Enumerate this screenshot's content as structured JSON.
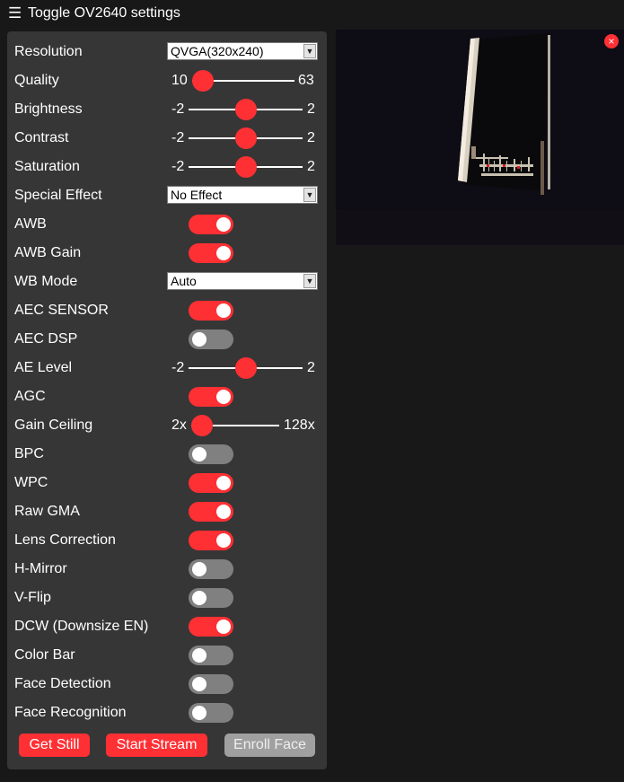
{
  "header": {
    "menu_icon": "☰",
    "title": "Toggle OV2640 settings"
  },
  "settings": {
    "resolution": {
      "label": "Resolution",
      "value": "QVGA(320x240)",
      "arrow": "▼"
    },
    "quality": {
      "label": "Quality",
      "min": "10",
      "max": "63",
      "value": 10
    },
    "brightness": {
      "label": "Brightness",
      "min": "-2",
      "max": "2",
      "value": 0
    },
    "contrast": {
      "label": "Contrast",
      "min": "-2",
      "max": "2",
      "value": 0
    },
    "saturation": {
      "label": "Saturation",
      "min": "-2",
      "max": "2",
      "value": 0
    },
    "special_effect": {
      "label": "Special Effect",
      "value": "No Effect",
      "arrow": "▼"
    },
    "awb": {
      "label": "AWB",
      "on": true
    },
    "awb_gain": {
      "label": "AWB Gain",
      "on": true
    },
    "wb_mode": {
      "label": "WB Mode",
      "value": "Auto",
      "arrow": "▼"
    },
    "aec_sensor": {
      "label": "AEC SENSOR",
      "on": true
    },
    "aec_dsp": {
      "label": "AEC DSP",
      "on": false
    },
    "ae_level": {
      "label": "AE Level",
      "min": "-2",
      "max": "2",
      "value": 0
    },
    "agc": {
      "label": "AGC",
      "on": true
    },
    "gain_ceiling": {
      "label": "Gain Ceiling",
      "min": "2x",
      "max": "128x",
      "value": "2x"
    },
    "bpc": {
      "label": "BPC",
      "on": false
    },
    "wpc": {
      "label": "WPC",
      "on": true
    },
    "raw_gma": {
      "label": "Raw GMA",
      "on": true
    },
    "lens_correction": {
      "label": "Lens Correction",
      "on": true
    },
    "h_mirror": {
      "label": "H-Mirror",
      "on": false
    },
    "v_flip": {
      "label": "V-Flip",
      "on": false
    },
    "dcw": {
      "label": "DCW (Downsize EN)",
      "on": true
    },
    "color_bar": {
      "label": "Color Bar",
      "on": false
    },
    "face_detection": {
      "label": "Face Detection",
      "on": false
    },
    "face_recognition": {
      "label": "Face Recognition",
      "on": false
    }
  },
  "buttons": {
    "get_still": "Get Still",
    "start_stream": "Start Stream",
    "enroll_face": "Enroll Face"
  },
  "stream": {
    "close_icon": "×"
  },
  "colors": {
    "accent": "#ff3034",
    "toggle_off": "#808080",
    "panel_bg": "#363636",
    "page_bg": "#181818",
    "disabled_button": "#a0a0a0"
  }
}
